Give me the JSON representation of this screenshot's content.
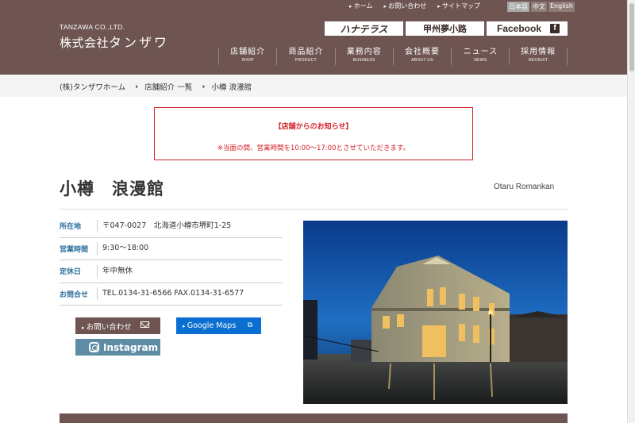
{
  "header": {
    "logo_en": "TANZAWA CO.,LTD.",
    "logo_ja_prefix": "株式会社",
    "logo_ja_main": "タンザワ",
    "utility_links": [
      "ホーム",
      "お問い合わせ",
      "サイトマップ"
    ],
    "languages": [
      "日本語",
      "中文",
      "English"
    ],
    "banners": [
      "ハナテラス",
      "甲州夢小路",
      "Facebook"
    ],
    "nav": [
      {
        "ja": "店舗紹介",
        "en": "SHOP"
      },
      {
        "ja": "商品紹介",
        "en": "PRODUCT"
      },
      {
        "ja": "業務内容",
        "en": "BUSINESS"
      },
      {
        "ja": "会社概要",
        "en": "ABOUT US"
      },
      {
        "ja": "ニュース",
        "en": "NEWS"
      },
      {
        "ja": "採用情報",
        "en": "RECRUIT"
      }
    ]
  },
  "breadcrumb": [
    "(株)タンザワホーム",
    "店舗紹介 一覧",
    "小樽 浪漫館"
  ],
  "notice": {
    "title": "【店舗からのお知らせ】",
    "text": "※当面の間、営業時間を10:00～17:00とさせていただきます。"
  },
  "store": {
    "name_ja": "小樽　浪漫館",
    "name_en": "Otaru Romankan",
    "info": [
      {
        "label": "所在地",
        "value": "〒047-0027　北海道小樽市堺町1-25"
      },
      {
        "label": "営業時間",
        "value": "9:30〜18:00"
      },
      {
        "label": "定休日",
        "value": "年中無休"
      },
      {
        "label": "お問合せ",
        "value": "TEL.0134-31-6566 FAX.0134-31-6577"
      }
    ]
  },
  "buttons": {
    "contact": "お問い合わせ",
    "maps": "Google Maps",
    "instagram": "Instagram"
  },
  "colors": {
    "brand_brown": "#6e5552",
    "notice_red": "#d3222a",
    "label_blue": "#2c6e9c",
    "maps_blue": "#0b6fd1"
  }
}
